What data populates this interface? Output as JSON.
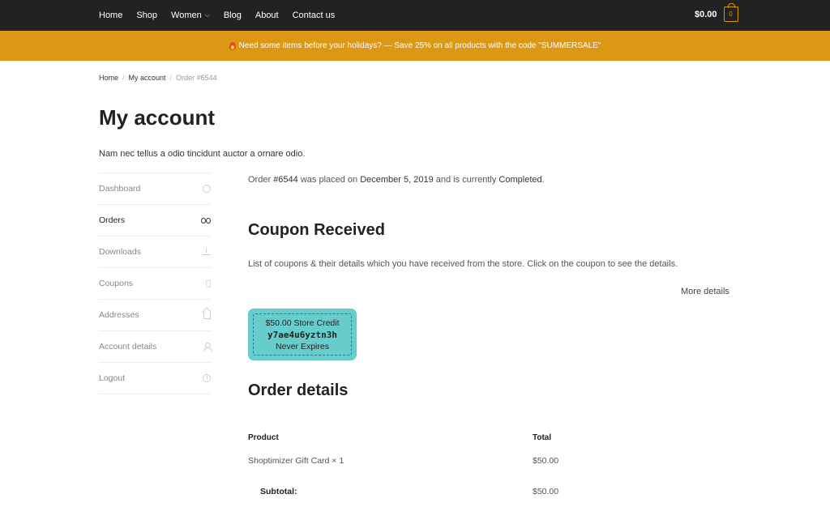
{
  "nav": {
    "items": [
      {
        "label": "Home"
      },
      {
        "label": "Shop"
      },
      {
        "label": "Women"
      },
      {
        "label": "Blog"
      },
      {
        "label": "About"
      },
      {
        "label": "Contact us"
      }
    ],
    "cart_total": "$0.00",
    "cart_count": "0"
  },
  "promo": {
    "text": "Need some items before your holidays? — Save 25% on all products with the code \"SUMMERSALE\""
  },
  "breadcrumb": {
    "home": "Home",
    "account": "My account",
    "current": "Order #6544"
  },
  "page": {
    "title": "My account",
    "intro": "Nam nec tellus a odio tincidunt auctor a ornare odio."
  },
  "sidebar": {
    "items": [
      {
        "label": "Dashboard"
      },
      {
        "label": "Orders"
      },
      {
        "label": "Downloads"
      },
      {
        "label": "Coupons"
      },
      {
        "label": "Addresses"
      },
      {
        "label": "Account details"
      },
      {
        "label": "Logout"
      }
    ]
  },
  "order": {
    "prefix": "Order ",
    "number": "#6544",
    "mid": " was placed on ",
    "date": "December 5, 2019",
    "mid2": " and is currently ",
    "status": "Completed",
    "suffix": "."
  },
  "coupons": {
    "heading": "Coupon Received",
    "description": "List of coupons & their details which you have received from the store. Click on the coupon to see the details.",
    "more_details": "More details",
    "coupon": {
      "amount": "$50.00 Store Credit",
      "code": "y7ae4u6yztn3h",
      "expiry": "Never Expires"
    }
  },
  "order_details": {
    "heading": "Order details",
    "col_product": "Product",
    "col_total": "Total",
    "item_name": "Shoptimizer Gift Card × 1",
    "item_total": "$50.00",
    "subtotal_label": "Subtotal:",
    "subtotal_value": "$50.00"
  },
  "colors": {
    "topbar": "#222222",
    "promo": "#dc9814",
    "coupon": "#66cccc"
  }
}
